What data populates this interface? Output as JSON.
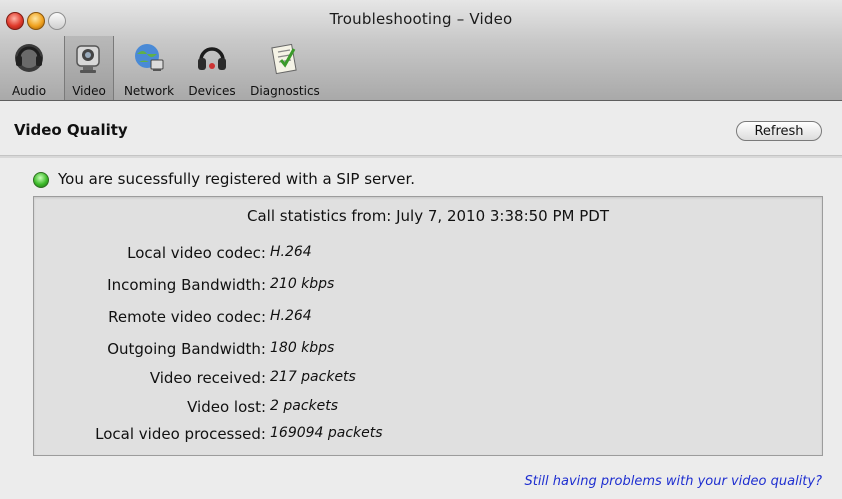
{
  "window": {
    "title": "Troubleshooting – Video"
  },
  "toolbar": {
    "items": [
      {
        "label": "Audio",
        "icon": "headset-icon",
        "selected": false
      },
      {
        "label": "Video",
        "icon": "video-icon",
        "selected": true
      },
      {
        "label": "Network",
        "icon": "network-icon",
        "selected": false
      },
      {
        "label": "Devices",
        "icon": "headphones-icon",
        "selected": false
      },
      {
        "label": "Diagnostics",
        "icon": "diagnostics-icon",
        "selected": false
      }
    ]
  },
  "section": {
    "title": "Video Quality",
    "refresh_label": "Refresh"
  },
  "status": {
    "text": "You are sucessfully registered with a SIP server.",
    "color": "#3dbb2a"
  },
  "stats": {
    "header": "Call statistics from: July 7, 2010 3:38:50 PM PDT",
    "rows": [
      {
        "label": "Local video codec:",
        "value": "H.264"
      },
      {
        "label": "Incoming Bandwidth:",
        "value": "210 kbps"
      },
      {
        "label": "Remote video codec:",
        "value": "H.264"
      },
      {
        "label": "Outgoing Bandwidth:",
        "value": "180 kbps"
      },
      {
        "label": "Video received:",
        "value": "217 packets"
      },
      {
        "label": "Video lost:",
        "value": "2 packets"
      },
      {
        "label": "Local video processed:",
        "value": "169094 packets"
      }
    ]
  },
  "footer": {
    "help_link": "Still having problems with your video quality?",
    "link_color": "#1f2fd0"
  }
}
